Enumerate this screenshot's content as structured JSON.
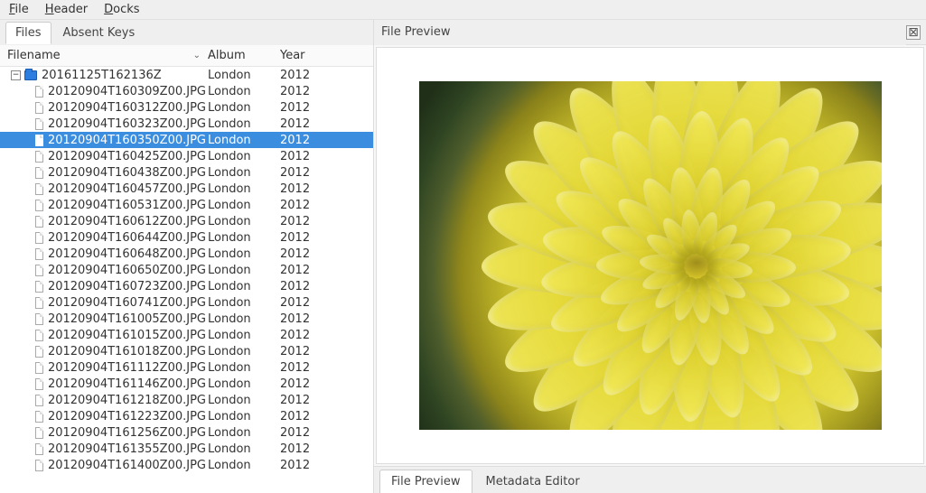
{
  "menubar": {
    "file": "File",
    "header": "Header",
    "docks": "Docks"
  },
  "leftTabs": {
    "files": "Files",
    "absentKeys": "Absent Keys"
  },
  "columns": {
    "filename": "Filename",
    "album": "Album",
    "year": "Year"
  },
  "folder": {
    "name": "20161125T162136Z",
    "album": "London",
    "year": "2012"
  },
  "files": [
    {
      "name": "20120904T160309Z00.JPG",
      "album": "London",
      "year": "2012",
      "selected": false
    },
    {
      "name": "20120904T160312Z00.JPG",
      "album": "London",
      "year": "2012",
      "selected": false
    },
    {
      "name": "20120904T160323Z00.JPG",
      "album": "London",
      "year": "2012",
      "selected": false
    },
    {
      "name": "20120904T160350Z00.JPG",
      "album": "London",
      "year": "2012",
      "selected": true
    },
    {
      "name": "20120904T160425Z00.JPG",
      "album": "London",
      "year": "2012",
      "selected": false
    },
    {
      "name": "20120904T160438Z00.JPG",
      "album": "London",
      "year": "2012",
      "selected": false
    },
    {
      "name": "20120904T160457Z00.JPG",
      "album": "London",
      "year": "2012",
      "selected": false
    },
    {
      "name": "20120904T160531Z00.JPG",
      "album": "London",
      "year": "2012",
      "selected": false
    },
    {
      "name": "20120904T160612Z00.JPG",
      "album": "London",
      "year": "2012",
      "selected": false
    },
    {
      "name": "20120904T160644Z00.JPG",
      "album": "London",
      "year": "2012",
      "selected": false
    },
    {
      "name": "20120904T160648Z00.JPG",
      "album": "London",
      "year": "2012",
      "selected": false
    },
    {
      "name": "20120904T160650Z00.JPG",
      "album": "London",
      "year": "2012",
      "selected": false
    },
    {
      "name": "20120904T160723Z00.JPG",
      "album": "London",
      "year": "2012",
      "selected": false
    },
    {
      "name": "20120904T160741Z00.JPG",
      "album": "London",
      "year": "2012",
      "selected": false
    },
    {
      "name": "20120904T161005Z00.JPG",
      "album": "London",
      "year": "2012",
      "selected": false
    },
    {
      "name": "20120904T161015Z00.JPG",
      "album": "London",
      "year": "2012",
      "selected": false
    },
    {
      "name": "20120904T161018Z00.JPG",
      "album": "London",
      "year": "2012",
      "selected": false
    },
    {
      "name": "20120904T161112Z00.JPG",
      "album": "London",
      "year": "2012",
      "selected": false
    },
    {
      "name": "20120904T161146Z00.JPG",
      "album": "London",
      "year": "2012",
      "selected": false
    },
    {
      "name": "20120904T161218Z00.JPG",
      "album": "London",
      "year": "2012",
      "selected": false
    },
    {
      "name": "20120904T161223Z00.JPG",
      "album": "London",
      "year": "2012",
      "selected": false
    },
    {
      "name": "20120904T161256Z00.JPG",
      "album": "London",
      "year": "2012",
      "selected": false
    },
    {
      "name": "20120904T161355Z00.JPG",
      "album": "London",
      "year": "2012",
      "selected": false
    },
    {
      "name": "20120904T161400Z00.JPG",
      "album": "London",
      "year": "2012",
      "selected": false
    }
  ],
  "preview": {
    "title": "File Preview"
  },
  "bottomTabs": {
    "filePreview": "File Preview",
    "metadataEditor": "Metadata Editor"
  }
}
